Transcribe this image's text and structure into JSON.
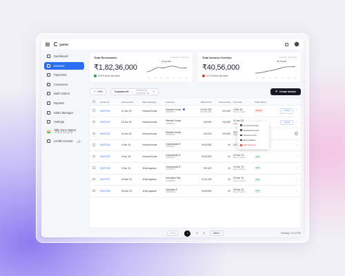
{
  "app": {
    "logo_text": "QAPAY"
  },
  "sidebar": {
    "items": [
      {
        "label": "Dashboard",
        "icon": "dashboard-icon"
      },
      {
        "label": "Invoices",
        "icon": "invoice-icon",
        "active": true
      },
      {
        "label": "Payments",
        "icon": "payment-icon"
      },
      {
        "label": "Customers",
        "icon": "customers-icon"
      },
      {
        "label": "Bulk Actions",
        "icon": "bulk-icon"
      },
      {
        "label": "Reports",
        "icon": "reports-icon"
      },
      {
        "label": "Sales Manager",
        "icon": "sales-manager-icon"
      },
      {
        "label": "Settings",
        "icon": "settings-icon"
      }
    ],
    "sync": {
      "label": "Tally Sync Status",
      "sub": "• Feb 14, 10:23 PM"
    },
    "credit": {
      "label": "Credit Console"
    }
  },
  "cards": {
    "receivables": {
      "title": "Total Receivables",
      "period": "1 Feb 25 - 8 Feb 25",
      "amount": "₹1,82,36,000",
      "trend": "18.5% since last week",
      "tooltip": "₹2,30,000",
      "days": [
        "S",
        "M",
        "T",
        "W",
        "T",
        "F",
        "S"
      ],
      "trend_color": "#2b9a4c"
    },
    "overdue": {
      "title": "Total Amount Overdue",
      "period": "1 Feb 25 - 8 Feb 25",
      "amount": "₹40,56,000",
      "trend": "12.4% since last week",
      "tooltip": "₹6,70,000",
      "days": [
        "S",
        "M",
        "T",
        "W",
        "T",
        "F",
        "S"
      ],
      "trend_color": "#e23b3b"
    }
  },
  "filterbar": {
    "filter_label": "Filter",
    "select_label": "Customer ID",
    "search_placeholder": "Search by customer ID",
    "create_label": "Create Invoice"
  },
  "table": {
    "headers": [
      "Invoice ID",
      "Invoice Date",
      "Sales Manager",
      "Customer",
      "Bill Amount",
      "Due Amount",
      "Due Date",
      "Order Status",
      ""
    ],
    "rows": [
      {
        "id": "INV07234",
        "date": "21 Jan '25",
        "manager": "Krishna Kumar",
        "customer": "Ramesh Kumar",
        "cust_id": "SUP89703",
        "bill": "₹10,00,000",
        "bill_sub": "Paid ₹40,000",
        "due": "₹20,000",
        "due_date": "4 Feb '25",
        "due_sub": "Due in 4 Days",
        "status": "Unpaid",
        "status_class": "unpaid",
        "action": "Invoice",
        "zoho": true
      },
      {
        "id": "INV07233",
        "date": "18 Jan '25",
        "manager": "Krishna Kumar",
        "customer": "Ramesh Kumar",
        "cust_id": "SUP89703",
        "bill": "₹16,000",
        "bill_sub": "",
        "due": "₹16,000",
        "due_date": "30 Jan '25",
        "due_sub": "Overdue by 1 day",
        "due_sub_red": true,
        "status": "Unpaid",
        "status_class": "unpaid",
        "action": "Invoice"
      },
      {
        "id": "INV07232",
        "date": "18 Jan '25",
        "manager": "Krishna Kumar",
        "customer": "Ramesh Kumar",
        "cust_id": "SUP89703",
        "bill": "₹20,000",
        "bill_sub": "",
        "due": "₹20,000",
        "due_date": "28 Jan '25",
        "due_sub": "Overdue by 3 days",
        "due_sub_red": true,
        "status": "Pending",
        "status_class": "pending",
        "action": "",
        "ring": true
      },
      {
        "id": "INV07230",
        "date": "4 Dec '24",
        "manager": "Krishna Kumar",
        "customer": "Gnaneshwar R.",
        "cust_id": "SUP89703",
        "bill": "₹5,43,653",
        "bill_sub": "",
        "due": "₹0",
        "due_date": "20 Dec '24",
        "due_sub": "",
        "status": "Cancelled",
        "status_class": "cancelled",
        "action": ""
      },
      {
        "id": "INV07229",
        "date": "4 Dec '24",
        "manager": "Krishna Kumar",
        "customer": "Gnaneshwar R.",
        "cust_id": "SUP89703",
        "bill": "₹5,43,653",
        "bill_sub": "",
        "due": "₹0",
        "due_date": "20 Dec '24",
        "due_sub": "Due in 4 Days",
        "status": "Paid",
        "status_class": "paid",
        "action": ""
      },
      {
        "id": "INV07228",
        "date": "4 Dec '24",
        "manager": "Vivek Agarwal",
        "customer": "Gnaneshwar R.",
        "cust_id": "SUP89703",
        "bill": "₹57,622",
        "bill_sub": "",
        "due": "₹0",
        "due_date": "20 Dec '24",
        "due_sub": "Due in 4 Days",
        "status": "Paid",
        "status_class": "paid",
        "action": ""
      },
      {
        "id": "INV07227",
        "date": "20 Nov '24",
        "manager": "Vivek Agarwal",
        "customer": "Karunakar She...",
        "cust_id": "SUP89703",
        "bill": "₹1,41,299",
        "bill_sub": "",
        "due": "₹0",
        "due_date": "30 Nov '24",
        "due_sub": "Due in 4 Days",
        "status": "Paid",
        "status_class": "paid",
        "action": ""
      },
      {
        "id": "INV07226",
        "date": "18 Nov '24",
        "manager": "Vivek Agarwal",
        "customer": "Hariharan P",
        "cust_id": "SUP89703",
        "bill": "₹5,43,653",
        "bill_sub": "",
        "due": "₹0",
        "due_date": "28 Nov '24",
        "due_sub": "Due in 4 Days",
        "status": "Paid",
        "status_class": "paid",
        "action": ""
      }
    ]
  },
  "context_menu": [
    {
      "label": "Invoice Summary",
      "red": false
    },
    {
      "label": "Download Invoice",
      "red": false
    },
    {
      "label": "Cancel Invoice",
      "red": false
    },
    {
      "label": "Reconciliation",
      "red": false
    },
    {
      "label": "Mark Disputes",
      "red": true
    }
  ],
  "pagination": {
    "prev": "Prev",
    "next": "Next",
    "pages": [
      "1",
      "2",
      "3"
    ],
    "current": "1",
    "showing": "Showing 1-10 of 200"
  }
}
